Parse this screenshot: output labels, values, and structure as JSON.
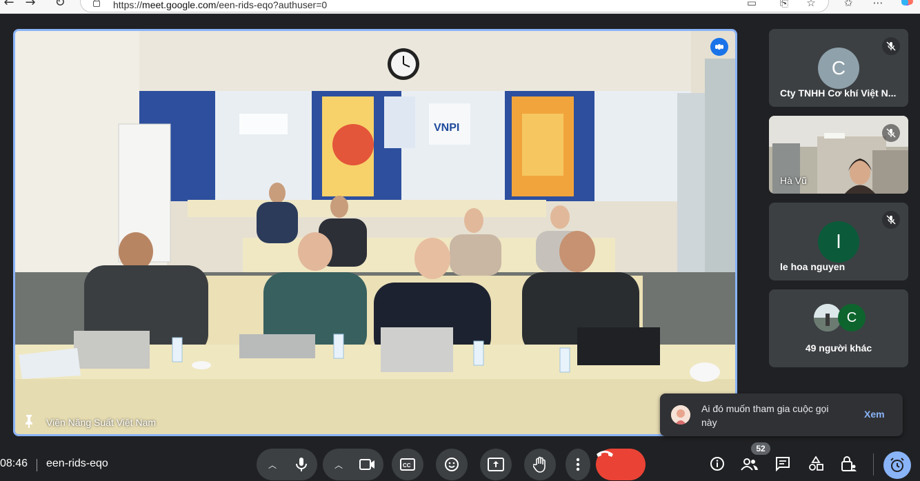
{
  "browser": {
    "url_prefix": "https://",
    "url_host": "meet.google.com",
    "url_path": "/een-rids-eqo?authuser=0"
  },
  "main_video": {
    "participant_name": "Viện Năng Suất Việt Nam",
    "speaking_color": "#1a73e8"
  },
  "side_tiles": [
    {
      "name": "Cty TNHH Cơ khí Việt N...",
      "avatar_letter": "C",
      "avatar_color": "#8fa1ab",
      "muted": true
    },
    {
      "name": "Hà Vũ",
      "muted": true
    },
    {
      "name": "le hoa nguyen",
      "avatar_letter": "l",
      "avatar_color": "#0b5a3a",
      "muted": true
    },
    {
      "name": "49 người khác",
      "avatar_letter": "C"
    }
  ],
  "notification": {
    "text": "Ai đó muốn tham gia cuộc gọi này",
    "action": "Xem"
  },
  "bottom_bar": {
    "time": "08:46",
    "meeting_code": "een-rids-eqo",
    "participants_count": "52"
  },
  "colors": {
    "background": "#202124",
    "active_border": "#8ab4f8",
    "end_call": "#ea4335",
    "accent": "#8ab4f8"
  }
}
